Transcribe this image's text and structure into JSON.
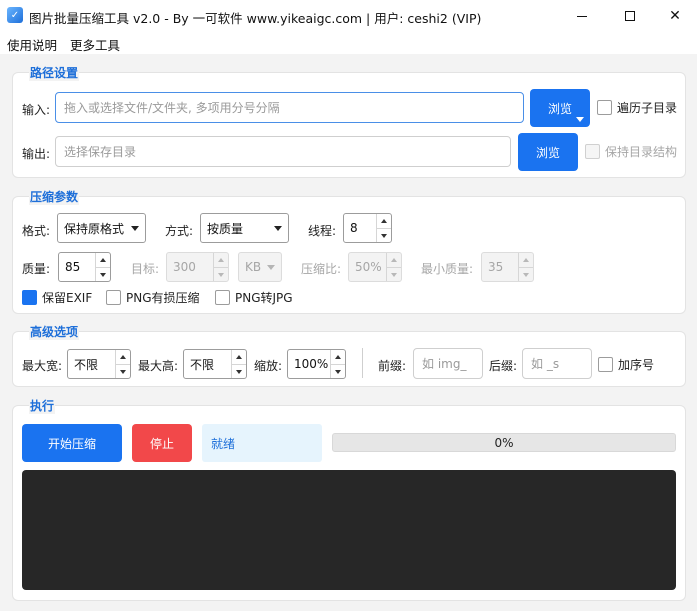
{
  "window": {
    "title": "图片批量压缩工具 v2.0 - By 一可软件 www.yikeaigc.com  |  用户: ceshi2 (VIP)"
  },
  "menu": [
    "使用说明",
    "更多工具"
  ],
  "path": {
    "title": "路径设置",
    "input_label": "输入:",
    "input_placeholder": "拖入或选择文件/文件夹, 多项用分号分隔",
    "browse_label": "浏览",
    "recursive_label": "遍历子目录",
    "output_label": "输出:",
    "output_placeholder": "选择保存目录",
    "output_browse_label": "浏览",
    "keep_structure_label": "保持目录结构"
  },
  "compress": {
    "title": "压缩参数",
    "format_label": "格式:",
    "format_value": "保持原格式",
    "mode_label": "方式:",
    "mode_value": "按质量",
    "threads_label": "线程:",
    "threads_value": "8",
    "quality_label": "质量:",
    "quality_value": "85",
    "target_label": "目标:",
    "target_value": "300",
    "target_unit": "KB",
    "ratio_label": "压缩比:",
    "ratio_value": "50%",
    "min_quality_label": "最小质量:",
    "min_quality_value": "35",
    "keep_exif_label": "保留EXIF",
    "keep_exif_checked": true,
    "png_lossy_label": "PNG有损压缩",
    "png_to_jpg_label": "PNG转JPG"
  },
  "advanced": {
    "title": "高级选项",
    "max_width_label": "最大宽:",
    "max_width_value": "不限",
    "max_height_label": "最大高:",
    "max_height_value": "不限",
    "scale_label": "缩放:",
    "scale_value": "100%",
    "prefix_label": "前缀:",
    "prefix_placeholder": "如 img_",
    "suffix_label": "后缀:",
    "suffix_placeholder": "如 _s",
    "seq_label": "加序号"
  },
  "execute": {
    "title": "执行",
    "start_label": "开始压缩",
    "stop_label": "停止",
    "status_text": "就绪",
    "progress_text": "0%",
    "progress_value": 0
  },
  "colors": {
    "accent": "#1a73f0",
    "stop": "#f2484a",
    "log_bg": "#272727"
  }
}
